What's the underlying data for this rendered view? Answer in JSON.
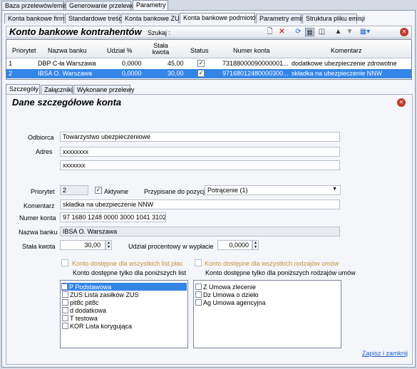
{
  "top_tabs": [
    "Baza przelewów/emisja",
    "Generowanie przelewów",
    "Parametry"
  ],
  "sub_tabs": [
    "Konta bankowe firmy",
    "Standardowe treści",
    "Konta bankowe ZUS",
    "Konta bankowe podmiotów",
    "Parametry emisji",
    "Struktura pliku emisji"
  ],
  "panel": {
    "title": "Konto bankowe kontrahentów",
    "search_label": "Szukaj :"
  },
  "grid": {
    "headers": [
      "Priorytet",
      "Nazwa banku",
      "Udział %",
      "Stała kwota",
      "Status",
      "Numer konta",
      "Komentarz"
    ],
    "rows": [
      {
        "priorytet": "1",
        "bank": "DBP C-ła Warszawa",
        "udzial": "0,0000",
        "kwota": "45,00",
        "status": "✓",
        "konto": "73188000090000001...",
        "komentarz": "dodatkowe ubezpieczenie zdrowotne"
      },
      {
        "priorytet": "2",
        "bank": "IBSA O. Warszawa",
        "udzial": "0,0000",
        "kwota": "30,00",
        "status": "✓",
        "konto": "97168012480000300...",
        "komentarz": "składka na ubezpieczenie NNW"
      }
    ]
  },
  "detail_tabs": [
    "Szczegóły",
    "Załączniki",
    "Wykonane przelewy"
  ],
  "detail": {
    "title": "Dane szczegółowe konta",
    "odbiorca_label": "Odbiorca",
    "odbiorca": "Towarzystwo ubezpieczeniowe",
    "adres_label": "Adres",
    "adres1": "xxxxxxxx",
    "adres2": "xxxxxxx",
    "priorytet_label": "Priorytet",
    "priorytet": "2",
    "aktywne_label": "Aktywne",
    "przypisane_label": "Przypisane do pozycji",
    "przypisane": "Potrącenie (1)",
    "komentarz_label": "Komentarz",
    "komentarz": "składka na ubezpieczenie NNW",
    "numer_label": "Numer konta",
    "numer": "97 1680 1248 0000 3000 1041 3102",
    "bank_label": "Nazwa banku",
    "bank": "IBSA O. Warszawa",
    "kwota_label": "Stała kwota",
    "kwota": "30,00",
    "udzial_label": "Udział procentowy w wypłacie",
    "udzial": "0,0000",
    "all_lists_label": "Konto dostępne dla wszystkich list płac",
    "only_lists_label": "Konto dostępne tylko dla poniższych list",
    "all_contracts_label": "Konto dostępne dla wszystkich rodzajów umów",
    "only_contracts_label": "Konto dostępne tylko dla poniższych rodzajów umów",
    "lists": [
      "P Podstawowa",
      "ZUS Lista zasiłków ZUS",
      "pit8c pit8c",
      "d dodatkowa",
      "T testowa",
      "KOR Lista korygująca"
    ],
    "contracts": [
      "Z Umowa zlecenie",
      "Dz Umowa o dzieło",
      "Ag Umowa agencyjna"
    ],
    "save_link": "Zapisz i zamknij"
  },
  "colors": {
    "selected_row": "#3385e6",
    "accent_orange": "#c8923a",
    "link": "#1f5fc8",
    "close_red": "#c0392b"
  }
}
